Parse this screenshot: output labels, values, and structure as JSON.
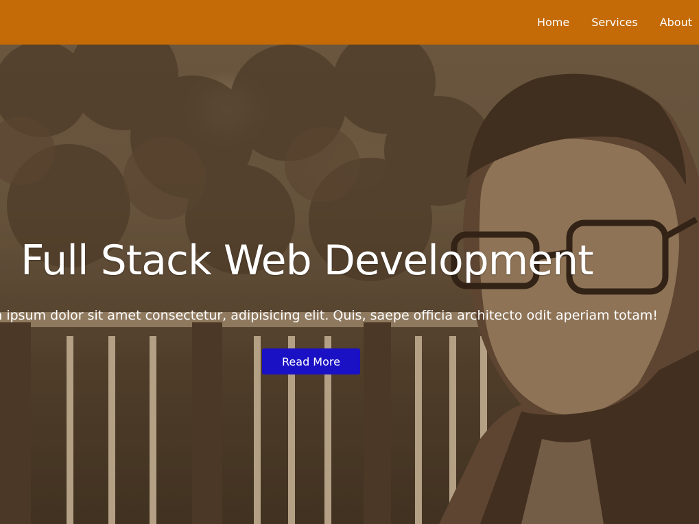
{
  "nav": {
    "links": [
      {
        "label": "Home"
      },
      {
        "label": "Services"
      },
      {
        "label": "About"
      }
    ],
    "background": "#c46a06"
  },
  "hero": {
    "title": "Full Stack Web Development",
    "subtitle": "n ipsum dolor sit amet consectetur, adipisicing elit. Quis, saepe officia architecto odit aperiam totam!",
    "button_label": "Read More",
    "button_color": "#1a10c4",
    "tint": "sepia"
  }
}
